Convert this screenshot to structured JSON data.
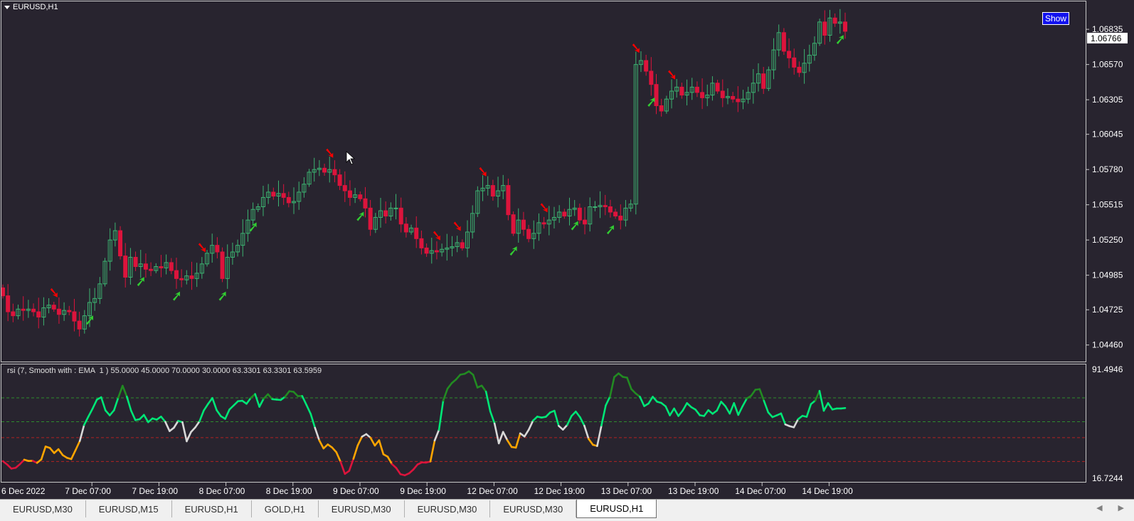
{
  "window": {
    "symbol_label": "EURUSD,H1",
    "show_button": "Show"
  },
  "tabs": [
    {
      "label": "EURUSD,M30",
      "active": false
    },
    {
      "label": "EURUSD,M15",
      "active": false
    },
    {
      "label": "EURUSD,H1",
      "active": false
    },
    {
      "label": "GOLD,H1",
      "active": false
    },
    {
      "label": "EURUSD,M30",
      "active": false
    },
    {
      "label": "EURUSD,M30",
      "active": false
    },
    {
      "label": "EURUSD,M30",
      "active": false
    },
    {
      "label": "EURUSD,H1",
      "active": true
    }
  ],
  "tab_nav": {
    "left": "◀",
    "right": "▶"
  },
  "colors": {
    "background": "#28242f",
    "bull_candle": "#3cb371",
    "bear_candle": "#dc143c",
    "buy_arrow": "#32cd32",
    "sell_arrow": "#ff0000",
    "rsi_strong_up": "#00e676",
    "rsi_up": "#228b22",
    "rsi_neutral": "#d8d8d8",
    "rsi_down": "#ffa500",
    "rsi_strong_down": "#dc143c",
    "level_green": "#2e8b2e",
    "level_red": "#b22222"
  },
  "chart_data": [
    {
      "type": "candlestick",
      "symbol": "EURUSD",
      "timeframe": "H1",
      "ylim": [
        1.0433,
        1.0705
      ],
      "yticks": [
        "1.06835",
        "1.06570",
        "1.06305",
        "1.06045",
        "1.05780",
        "1.05515",
        "1.05250",
        "1.04985",
        "1.04725",
        "1.04460"
      ],
      "current_price": "1.06766",
      "xticks": [
        "6 Dec 2022",
        "7 Dec 07:00",
        "7 Dec 19:00",
        "8 Dec 07:00",
        "8 Dec 19:00",
        "9 Dec 07:00",
        "9 Dec 19:00",
        "12 Dec 07:00",
        "12 Dec 19:00",
        "13 Dec 07:00",
        "13 Dec 19:00",
        "14 Dec 07:00",
        "14 Dec 19:00"
      ],
      "close": [
        1.0483,
        1.0471,
        1.0468,
        1.0473,
        1.0472,
        1.0473,
        1.0471,
        1.0467,
        1.0474,
        1.0476,
        1.0473,
        1.0469,
        1.0472,
        1.0471,
        1.0464,
        1.0458,
        1.0468,
        1.0478,
        1.0481,
        1.0492,
        1.0509,
        1.0525,
        1.0532,
        1.0513,
        1.0497,
        1.0512,
        1.0505,
        1.0507,
        1.0503,
        1.0502,
        1.0505,
        1.0504,
        1.0508,
        1.0502,
        1.0496,
        1.0495,
        1.0498,
        1.0496,
        1.05,
        1.0507,
        1.0515,
        1.0521,
        1.0516,
        1.0496,
        1.0512,
        1.0516,
        1.0521,
        1.053,
        1.054,
        1.0548,
        1.055,
        1.0557,
        1.0561,
        1.0558,
        1.056,
        1.0557,
        1.0553,
        1.0554,
        1.0561,
        1.0567,
        1.0576,
        1.0578,
        1.0579,
        1.0576,
        1.0578,
        1.0574,
        1.0566,
        1.0562,
        1.0557,
        1.0559,
        1.0556,
        1.0549,
        1.0533,
        1.0542,
        1.0547,
        1.0543,
        1.0549,
        1.0549,
        1.0537,
        1.0531,
        1.0534,
        1.0526,
        1.0519,
        1.0515,
        1.0517,
        1.0516,
        1.0518,
        1.0519,
        1.052,
        1.0523,
        1.0519,
        1.0531,
        1.0545,
        1.0562,
        1.0564,
        1.0566,
        1.0558,
        1.0562,
        1.0566,
        1.0544,
        1.053,
        1.054,
        1.0533,
        1.0526,
        1.053,
        1.0538,
        1.0537,
        1.054,
        1.0542,
        1.0546,
        1.0543,
        1.0548,
        1.0549,
        1.054,
        1.0537,
        1.055,
        1.055,
        1.0551,
        1.055,
        1.0546,
        1.0543,
        1.054,
        1.0549,
        1.0552,
        1.0657,
        1.066,
        1.0652,
        1.0642,
        1.0626,
        1.0622,
        1.0631,
        1.0637,
        1.064,
        1.0634,
        1.0636,
        1.064,
        1.0636,
        1.0632,
        1.0634,
        1.0643,
        1.0637,
        1.0632,
        1.0633,
        1.0631,
        1.0629,
        1.0631,
        1.0636,
        1.0643,
        1.065,
        1.0639,
        1.0653,
        1.0668,
        1.0681,
        1.0667,
        1.0662,
        1.0655,
        1.0651,
        1.0658,
        1.0664,
        1.0673,
        1.0689,
        1.0679,
        1.0692,
        1.0688,
        1.0689,
        1.0682
      ],
      "signals": {
        "buy_index": [
          17,
          27,
          34,
          43,
          49,
          70,
          100,
          112,
          119,
          127,
          164,
          176
        ],
        "sell_index": [
          10,
          39,
          64,
          85,
          89,
          94,
          106,
          124,
          131
        ]
      }
    },
    {
      "type": "line",
      "label": "rsi (7, Smooth with : EMA  1 ) 55.0000 45.0000 70.0000 30.0000 63.3301 63.3301 63.5959",
      "ylim": [
        16.7244,
        91.4946
      ],
      "yticks": [
        "91.4946",
        "16.7244"
      ],
      "levels": [
        70,
        55,
        45,
        30
      ],
      "series": [
        {
          "values": [
            30.2,
            28.1,
            25.5,
            26.0,
            28.3,
            31.1,
            30.3,
            30.4,
            29.1,
            31.3,
            39.4,
            38.5,
            35.3,
            37.7,
            34.0,
            32.3,
            31.5,
            37.1,
            42.9,
            52.9,
            58.2,
            63.3,
            68.9,
            70.4,
            62.1,
            59.0,
            62.2,
            70.2,
            77.6,
            70.8,
            61.9,
            56.0,
            56.6,
            59.3,
            54.7,
            57.1,
            56.3,
            58.2,
            54.9,
            49.1,
            51.2,
            55.5,
            54.7,
            42.7,
            48.5,
            51.4,
            55.3,
            62.1,
            66.2,
            69.9,
            62.3,
            58.5,
            56.8,
            62.7,
            65.3,
            67.9,
            68.2,
            66.3,
            70.0,
            72.4,
            64.4,
            69.5,
            72.3,
            69.2,
            68.9,
            68.7,
            70.7,
            74.2,
            73.8,
            71.1,
            71.2,
            65.6,
            59.9,
            51.2,
            43.3,
            38.2,
            40.7,
            38.8,
            35.8,
            29.7,
            22.2,
            24.1,
            31.7,
            40.1,
            45.6,
            47.2,
            44.9,
            40.0,
            43.3,
            34.5,
            33.0,
            28.4,
            25.9,
            22.0,
            21.3,
            22.5,
            24.9,
            28.1,
            29.4,
            29.3,
            30.0,
            43.2,
            49.9,
            68.3,
            75.8,
            79.3,
            81.6,
            84.6,
            85.1,
            86.7,
            84.5,
            76.5,
            77.7,
            73.9,
            61.5,
            53.9,
            41.4,
            48.6,
            43.3,
            39.1,
            38.7,
            47.7,
            45.7,
            50.0,
            55.7,
            58.2,
            57.6,
            58.1,
            60.8,
            61.9,
            52.4,
            50.0,
            53.0,
            58.6,
            61.4,
            57.8,
            52.5,
            44.2,
            40.5,
            39.7,
            52.6,
            65.2,
            70.8,
            83.1,
            85.4,
            83.2,
            82.7,
            75.5,
            72.8,
            70.7,
            64.8,
            66.4,
            70.7,
            67.6,
            66.8,
            64.7,
            59.0,
            63.3,
            58.6,
            62.0,
            66.7,
            64.2,
            62.6,
            59.1,
            58.6,
            62.3,
            60.0,
            62.0,
            67.6,
            64.7,
            60.1,
            66.7,
            59.3,
            64.7,
            69.6,
            71.3,
            75.1,
            75.5,
            68.2,
            60.9,
            57.9,
            59.0,
            60.2,
            53.3,
            52.2,
            51.5,
            56.6,
            58.7,
            58.1,
            66.1,
            68.3,
            74.4,
            61.9,
            66.7,
            62.7,
            63.3,
            63.3,
            63.6
          ]
        }
      ]
    }
  ]
}
